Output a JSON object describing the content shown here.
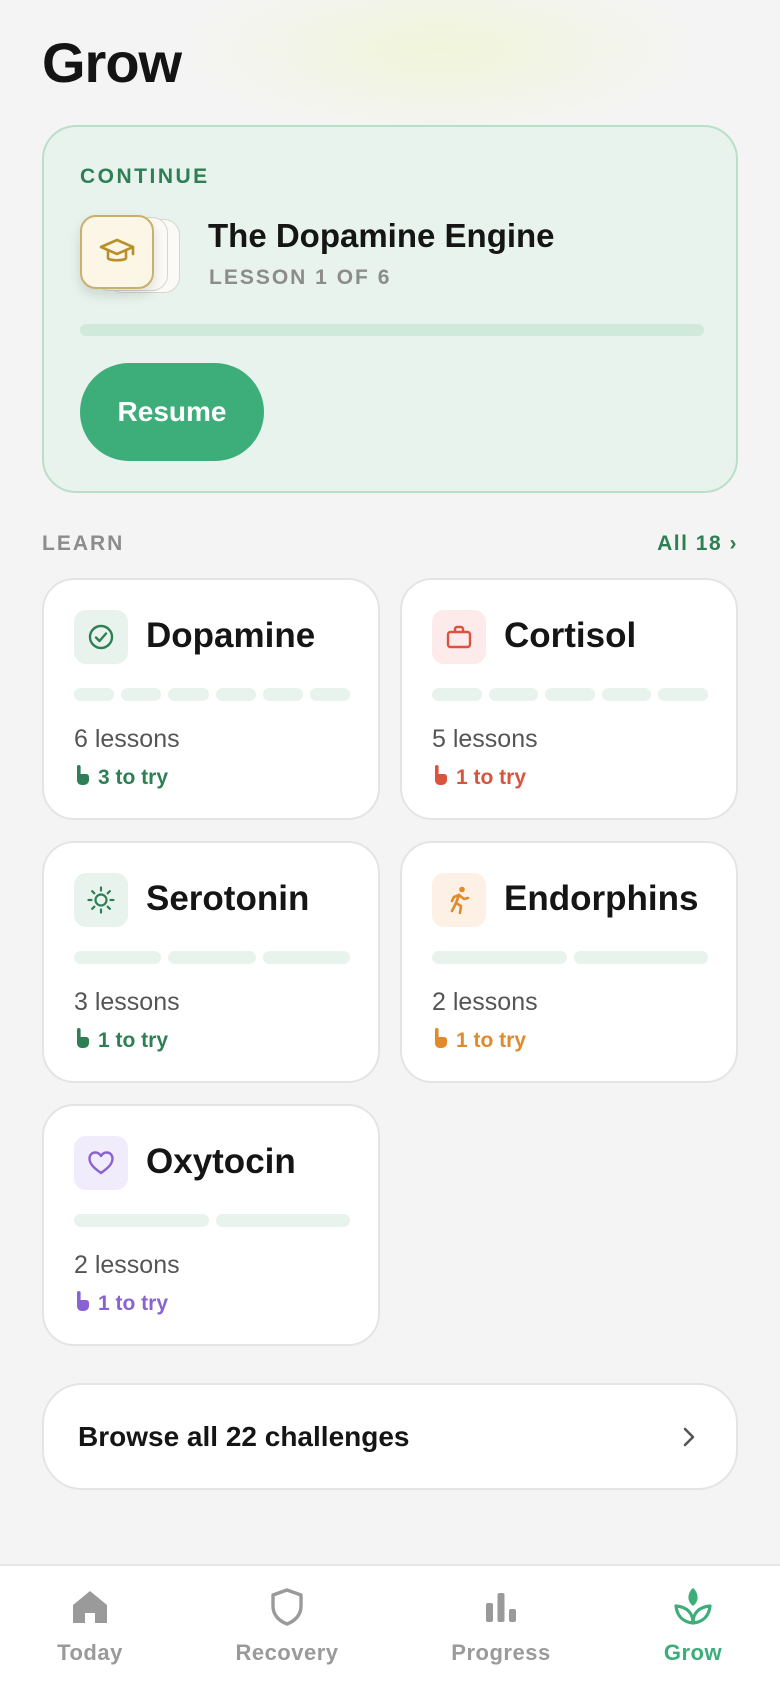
{
  "page": {
    "title": "Grow"
  },
  "continue_card": {
    "label": "CONTINUE",
    "lesson_title": "The Dopamine Engine",
    "lesson_progress": "LESSON 1 OF 6",
    "progress_fraction": 0,
    "resume_label": "Resume",
    "icon": "graduation-cap-icon"
  },
  "learn": {
    "label": "LEARN",
    "see_all": "All 18 ›",
    "topics": [
      {
        "name": "Dopamine",
        "lessons": "6 lessons",
        "to_try": "3 to try",
        "segments": 6,
        "icon": "check-circle-icon",
        "accent": "#2f7f55",
        "icon_bg": "#e7f3ec"
      },
      {
        "name": "Cortisol",
        "lessons": "5 lessons",
        "to_try": "1 to try",
        "segments": 5,
        "icon": "briefcase-icon",
        "accent": "#d9543f",
        "icon_bg": "#fdeaea"
      },
      {
        "name": "Serotonin",
        "lessons": "3 lessons",
        "to_try": "1 to try",
        "segments": 3,
        "icon": "sun-icon",
        "accent": "#2f7f55",
        "icon_bg": "#e7f3ec"
      },
      {
        "name": "Endorphins",
        "lessons": "2 lessons",
        "to_try": "1 to try",
        "segments": 2,
        "icon": "running-person-icon",
        "accent": "#e08a2c",
        "icon_bg": "#fdf0e4"
      },
      {
        "name": "Oxytocin",
        "lessons": "2 lessons",
        "to_try": "1 to try",
        "segments": 2,
        "icon": "heart-icon",
        "accent": "#8a63d2",
        "icon_bg": "#f1ecfb"
      }
    ]
  },
  "browse": {
    "label": "Browse all 22 challenges"
  },
  "nav": {
    "items": [
      {
        "label": "Today",
        "icon": "home-icon",
        "active": false
      },
      {
        "label": "Recovery",
        "icon": "shield-icon",
        "active": false
      },
      {
        "label": "Progress",
        "icon": "bar-chart-icon",
        "active": false
      },
      {
        "label": "Grow",
        "icon": "sprout-icon",
        "active": true
      }
    ],
    "active_color": "#3dae7a",
    "inactive_color": "#9a9a9a"
  }
}
